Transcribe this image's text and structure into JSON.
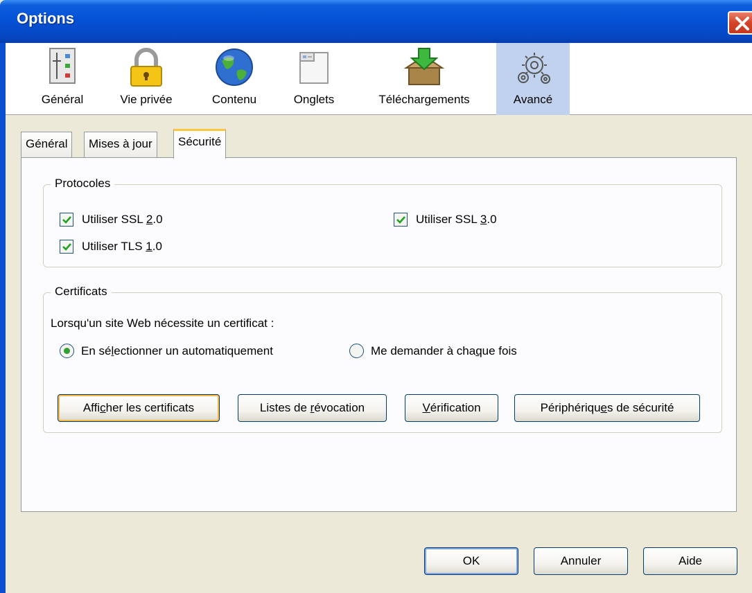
{
  "window": {
    "title": "Options"
  },
  "toolbar": {
    "items": [
      {
        "label": "Général",
        "icon": "settings-sliders-icon",
        "selected": false
      },
      {
        "label": "Vie privée",
        "icon": "padlock-icon",
        "selected": false
      },
      {
        "label": "Contenu",
        "icon": "globe-icon",
        "selected": false
      },
      {
        "label": "Onglets",
        "icon": "tabs-window-icon",
        "selected": false
      },
      {
        "label": "Téléchargements",
        "icon": "download-box-icon",
        "selected": false
      },
      {
        "label": "Avancé",
        "icon": "gears-icon",
        "selected": true
      }
    ]
  },
  "tabs": [
    {
      "label": "Général",
      "active": false
    },
    {
      "label": "Mises à jour",
      "active": false
    },
    {
      "label": "Sécurité",
      "active": true
    }
  ],
  "protocols": {
    "title": "Protocoles",
    "ssl2": {
      "pre": "Utiliser SSL ",
      "key": "2",
      "post": ".0",
      "checked": true
    },
    "ssl3": {
      "pre": "Utiliser SSL ",
      "key": "3",
      "post": ".0",
      "checked": true
    },
    "tls1": {
      "pre": "Utiliser TLS ",
      "key": "1",
      "post": ".0",
      "checked": true
    }
  },
  "certificates": {
    "title": "Certificats",
    "prompt": "Lorsqu'un site Web nécessite un certificat :",
    "auto": {
      "pre": "En sé",
      "key": "l",
      "post": "ectionner un automatiquement",
      "selected": true
    },
    "ask": {
      "pre": "Me demander à cha",
      "key": "q",
      "post": "ue fois",
      "selected": false
    },
    "buttons": {
      "view": {
        "pre": "Affi",
        "key": "c",
        "post": "her les certificats"
      },
      "revocation": {
        "pre": "Listes de ",
        "key": "r",
        "post": "évocation"
      },
      "verification": {
        "pre": "",
        "key": "V",
        "post": "érification"
      },
      "devices": {
        "pre": "Périphériqu",
        "key": "e",
        "post": "s de sécurité"
      }
    }
  },
  "dialog_buttons": {
    "ok": "OK",
    "cancel": "Annuler",
    "help": "Aide"
  },
  "colors": {
    "titlebar": "#0551d6",
    "selected_toolbar": "#c1d2ee",
    "check": "#21a121",
    "active_tab_accent": "#ffc83c"
  }
}
